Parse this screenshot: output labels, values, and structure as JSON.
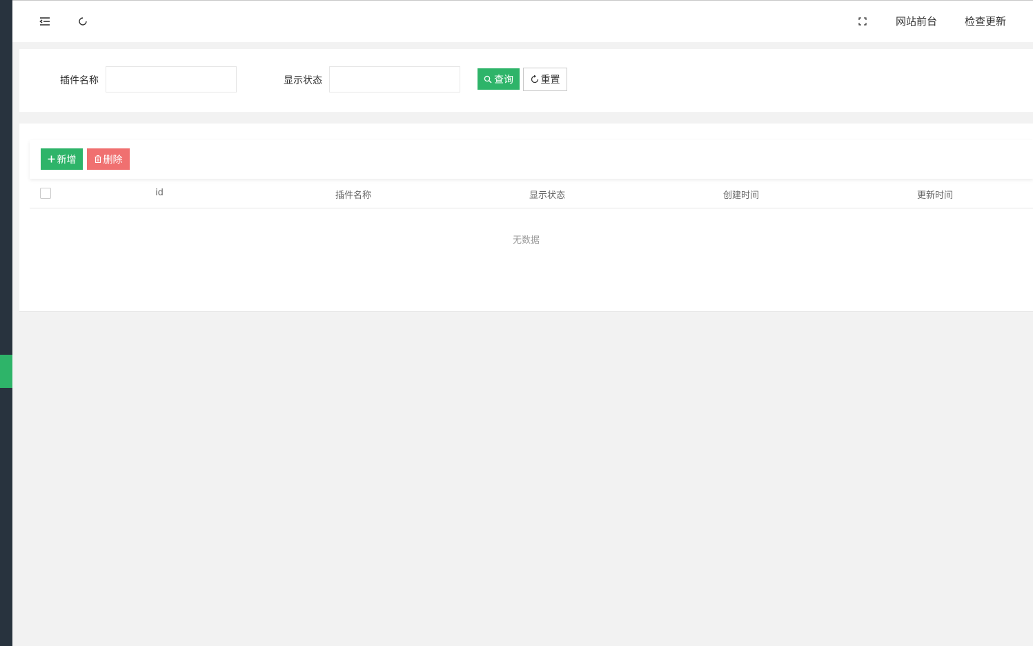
{
  "header": {
    "menu_toggle_icon": "menu-fold-icon",
    "refresh_icon": "refresh-icon",
    "fullscreen_icon": "fullscreen-icon",
    "frontend_link": "网站前台",
    "check_update_link": "检查更新"
  },
  "search": {
    "plugin_name_label": "插件名称",
    "plugin_name_value": "",
    "display_status_label": "显示状态",
    "display_status_value": "",
    "query_button": "查询",
    "reset_button": "重置"
  },
  "toolbar": {
    "add_button": "新增",
    "delete_button": "删除"
  },
  "table": {
    "columns": [
      "id",
      "插件名称",
      "显示状态",
      "创建时间",
      "更新时间"
    ],
    "rows": [],
    "empty_text": "无数据"
  },
  "colors": {
    "accent": "#2eb469",
    "danger": "#f07070",
    "sidebar": "#28333e"
  }
}
